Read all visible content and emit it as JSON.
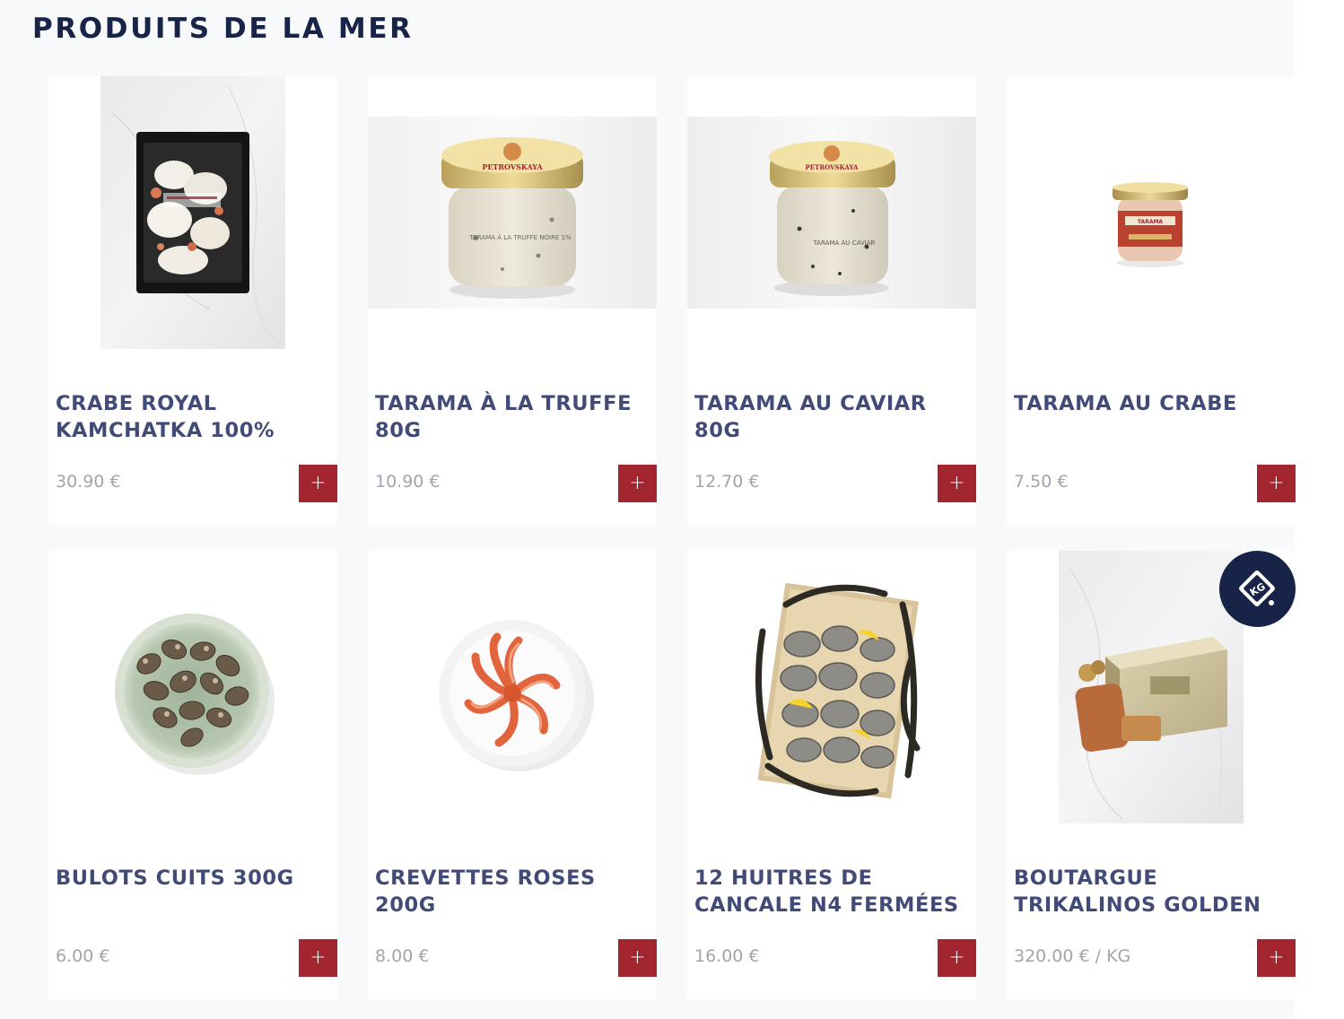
{
  "section": {
    "title": "PRODUITS DE LA MER"
  },
  "products": [
    {
      "name": "CRABE ROYAL KAMCHATKA 100%",
      "price": "30.90 €",
      "add_label": "+",
      "image_icon": "crab-meat-tray-image"
    },
    {
      "name": "TARAMA À LA TRUFFE 80G",
      "price": "10.90 €",
      "add_label": "+",
      "image_icon": "tarama-jar-image",
      "jar_brand": "PETROVSKAYA",
      "jar_label": "TARAMA À LA TRUFFE NOIRE 1%"
    },
    {
      "name": "TARAMA AU CAVIAR 80G",
      "price": "12.70 €",
      "add_label": "+",
      "image_icon": "tarama-jar-image",
      "jar_brand": "PETROVSKAYA",
      "jar_label": "TARAMA AU CAVIAR"
    },
    {
      "name": "TARAMA AU CRABE",
      "price": "7.50 €",
      "add_label": "+",
      "image_icon": "small-jar-image",
      "jar_label": "TARAMA"
    },
    {
      "name": "BULOTS CUITS 300G",
      "price": "6.00 €",
      "add_label": "+",
      "image_icon": "whelks-bowl-image"
    },
    {
      "name": "CREVETTES ROSES 200G",
      "price": "8.00 €",
      "add_label": "+",
      "image_icon": "shrimp-plate-image"
    },
    {
      "name": "12 HUITRES DE CANCALE N4 FERMÉES",
      "price": "16.00 €",
      "add_label": "+",
      "image_icon": "oyster-crate-image"
    },
    {
      "name": "BOUTARGUE TRIKALINOS GOLDEN",
      "price": "320.00 € / KG",
      "add_label": "+",
      "image_icon": "bottarga-box-image",
      "badge": {
        "label": "KG",
        "icon": "weight-kg-icon"
      }
    }
  ],
  "colors": {
    "title": "#172447",
    "product_name": "#424b78",
    "price": "#a2a4ab",
    "add_button": "#a3252f",
    "page_background": "#f8f9fb",
    "badge": "#172447"
  }
}
